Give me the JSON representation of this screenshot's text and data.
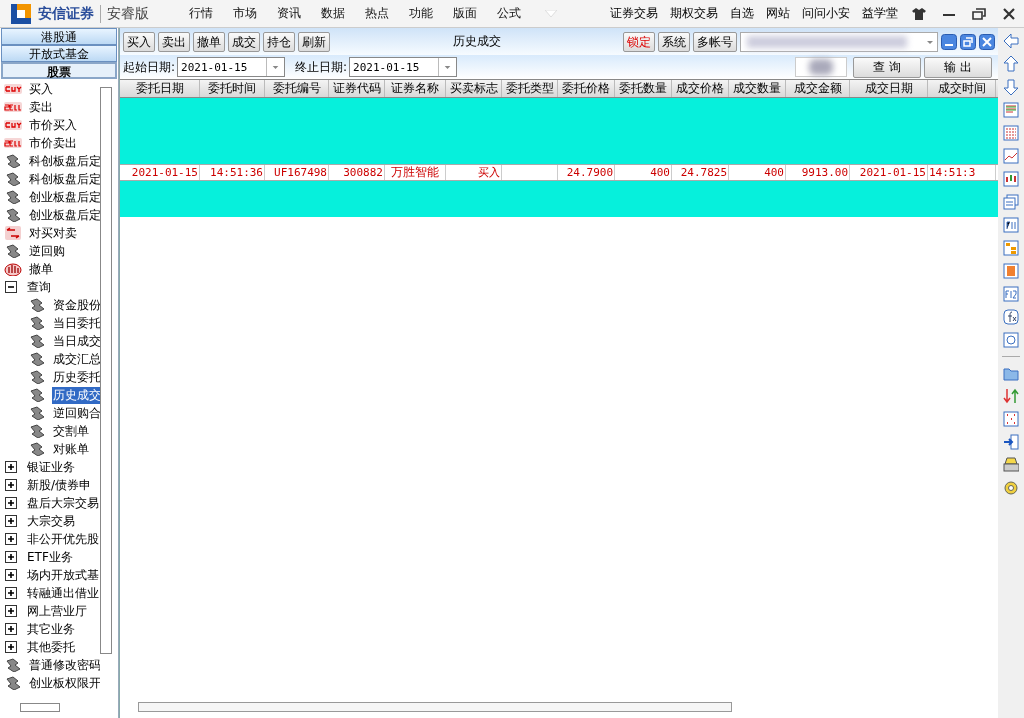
{
  "app": {
    "brand": "安信证券",
    "edition": "安睿版"
  },
  "menu": [
    "行情",
    "市场",
    "资讯",
    "数据",
    "热点",
    "功能",
    "版面",
    "公式"
  ],
  "menu_right": [
    "证券交易",
    "期权交易",
    "自选",
    "网站",
    "问问小安",
    "益学堂"
  ],
  "sidebar": {
    "tabs": [
      {
        "label": "港股通",
        "selected": false
      },
      {
        "label": "开放式基金",
        "selected": false
      },
      {
        "label": "股票",
        "selected": true
      }
    ],
    "tree": [
      {
        "label": "买入",
        "kind": "buy",
        "selected": false
      },
      {
        "label": "卖出",
        "kind": "sell",
        "selected": false
      },
      {
        "label": "市价买入",
        "kind": "buy",
        "selected": false
      },
      {
        "label": "市价卖出",
        "kind": "sell",
        "selected": false
      },
      {
        "label": "科创板盘后定",
        "kind": "tool",
        "selected": false
      },
      {
        "label": "科创板盘后定",
        "kind": "tool",
        "selected": false
      },
      {
        "label": "创业板盘后定",
        "kind": "tool",
        "selected": false
      },
      {
        "label": "创业板盘后定",
        "kind": "tool",
        "selected": false
      },
      {
        "label": "对买对卖",
        "kind": "pair",
        "selected": false
      },
      {
        "label": "逆回购",
        "kind": "tool",
        "selected": false
      },
      {
        "label": "撤单",
        "kind": "hand",
        "selected": false
      },
      {
        "label": "查询",
        "kind": "folder",
        "expanded": true,
        "selected": false,
        "children": [
          {
            "label": "资金股份",
            "kind": "tool",
            "selected": false
          },
          {
            "label": "当日委托",
            "kind": "tool",
            "selected": false
          },
          {
            "label": "当日成交",
            "kind": "tool",
            "selected": false
          },
          {
            "label": "成交汇总",
            "kind": "tool",
            "selected": false
          },
          {
            "label": "历史委托",
            "kind": "tool",
            "selected": false
          },
          {
            "label": "历史成交",
            "kind": "tool",
            "selected": true
          },
          {
            "label": "逆回购合",
            "kind": "tool",
            "selected": false
          },
          {
            "label": "交割单",
            "kind": "tool",
            "selected": false
          },
          {
            "label": "对账单",
            "kind": "tool",
            "selected": false
          }
        ]
      },
      {
        "label": "银证业务",
        "kind": "folder",
        "expanded": false,
        "selected": false
      },
      {
        "label": "新股/债券申",
        "kind": "folder",
        "expanded": false,
        "selected": false
      },
      {
        "label": "盘后大宗交易",
        "kind": "folder",
        "expanded": false,
        "selected": false
      },
      {
        "label": "大宗交易",
        "kind": "folder",
        "expanded": false,
        "selected": false
      },
      {
        "label": "非公开优先股",
        "kind": "folder",
        "expanded": false,
        "selected": false
      },
      {
        "label": "ETF业务",
        "kind": "folder",
        "expanded": false,
        "selected": false
      },
      {
        "label": "场内开放式基",
        "kind": "folder",
        "expanded": false,
        "selected": false
      },
      {
        "label": "转融通出借业",
        "kind": "folder",
        "expanded": false,
        "selected": false
      },
      {
        "label": "网上营业厅",
        "kind": "folder",
        "expanded": false,
        "selected": false
      },
      {
        "label": "其它业务",
        "kind": "folder",
        "expanded": false,
        "selected": false
      },
      {
        "label": "其他委托",
        "kind": "folder",
        "expanded": false,
        "selected": false
      },
      {
        "label": "普通修改密码",
        "kind": "tool",
        "selected": false
      },
      {
        "label": "创业板权限开",
        "kind": "tool",
        "selected": false
      }
    ]
  },
  "toolbar": {
    "buttons": [
      "买入",
      "卖出",
      "撤单",
      "成交",
      "持仓",
      "刷新"
    ],
    "title": "历史成交",
    "right_buttons": [
      {
        "label": "锁定",
        "kind": "alert"
      },
      {
        "label": "系统",
        "kind": "normal"
      },
      {
        "label": "多帐号",
        "kind": "normal"
      }
    ]
  },
  "filters": {
    "start_label": "起始日期:",
    "start_value": "2021-01-15",
    "end_label": "终止日期:",
    "end_value": "2021-01-15",
    "buttons": [
      "查 询",
      "输 出"
    ]
  },
  "table": {
    "columns": [
      "委托日期",
      "委托时间",
      "委托编号",
      "证券代码",
      "证券名称",
      "买卖标志",
      "委托类型",
      "委托价格",
      "委托数量",
      "成交价格",
      "成交数量",
      "成交金额",
      "成交日期",
      "成交时间"
    ],
    "rows": [
      [
        "2021-01-15",
        "14:51:36",
        "UF167498",
        "300882",
        "万胜智能",
        "买入",
        null,
        "24.7900",
        "400",
        "24.7825",
        "400",
        "9913.00",
        "2021-01-15",
        "14:51:3"
      ]
    ]
  }
}
